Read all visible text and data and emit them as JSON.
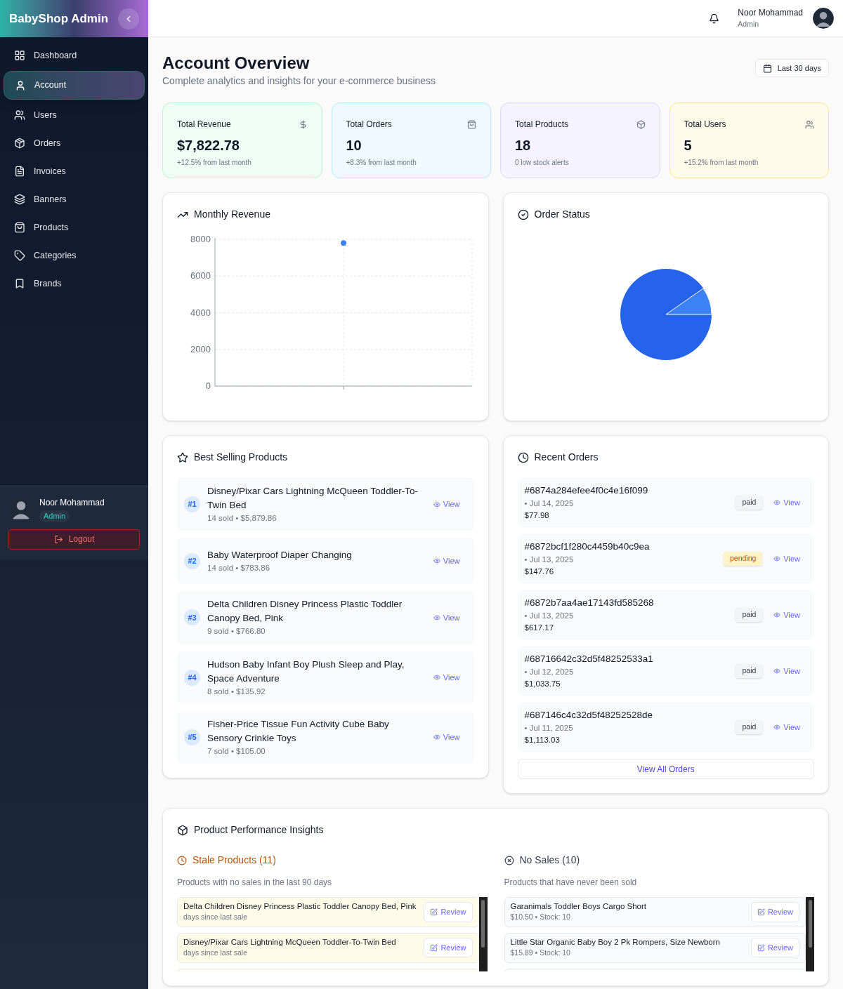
{
  "brand": "BabyShop Admin",
  "sidebar": {
    "items": [
      {
        "label": "Dashboard",
        "selected": false
      },
      {
        "label": "Account",
        "selected": true
      },
      {
        "label": "Users",
        "selected": false
      },
      {
        "label": "Orders",
        "selected": false
      },
      {
        "label": "Invoices",
        "selected": false
      },
      {
        "label": "Banners",
        "selected": false
      },
      {
        "label": "Products",
        "selected": false
      },
      {
        "label": "Categories",
        "selected": false
      },
      {
        "label": "Brands",
        "selected": false
      }
    ],
    "user": {
      "name": "Noor Mohammad",
      "role": "Admin"
    },
    "logout": "Logout"
  },
  "header": {
    "user": {
      "name": "Noor Mohammad",
      "role": "Admin"
    }
  },
  "page": {
    "title": "Account Overview",
    "subtitle": "Complete analytics and insights for your e-commerce business",
    "range": "Last 30 days"
  },
  "stats": [
    {
      "title": "Total Revenue",
      "value": "$7,822.78",
      "note": "+12.5% from last month",
      "color": "#f0fdf4"
    },
    {
      "title": "Total Orders",
      "value": "10",
      "note": "+8.3% from last month",
      "color": "#f0f9ff"
    },
    {
      "title": "Total Products",
      "value": "18",
      "note": "0 low stock alerts",
      "color": "#f5f3ff"
    },
    {
      "title": "Total Users",
      "value": "5",
      "note": "+15.2% from last month",
      "color": "#fffbeb"
    }
  ],
  "revenue": {
    "chart_data": {
      "type": "line",
      "title": "Monthly Revenue",
      "grid": true,
      "series": [
        {
          "color": "#3b82f6",
          "marker": true,
          "values": [
            7800
          ]
        }
      ],
      "ylim": [
        0,
        8000
      ],
      "yticks": [
        0,
        2000,
        4000,
        6000,
        8000
      ]
    }
  },
  "order_status": {
    "title": "Order Status"
  },
  "best_selling": {
    "title": "Best Selling Products",
    "items": [
      {
        "rank": "#1",
        "name": "Disney/Pixar Cars Lightning McQueen Toddler-To-Twin Bed",
        "sales": "14 sold • $5,879.86",
        "action": "View"
      },
      {
        "rank": "#2",
        "name": "Baby Waterproof Diaper Changing",
        "sales": "14 sold • $783.86",
        "action": "View"
      },
      {
        "rank": "#3",
        "name": "Delta Children Disney Princess Plastic Toddler Canopy Bed, Pink",
        "sales": "9 sold • $766.80",
        "action": "View"
      },
      {
        "rank": "#4",
        "name": "Hudson Baby Infant Boy Plush Sleep and Play, Space Adventure",
        "sales": "8 sold • $135.92",
        "action": "View"
      },
      {
        "rank": "#5",
        "name": "Fisher-Price Tissue Fun Activity Cube Baby Sensory Crinkle Toys",
        "sales": "7 sold • $105.00",
        "action": "View"
      }
    ]
  },
  "recent_orders": {
    "title": "Recent Orders",
    "items": [
      {
        "id": "#6874a284efee4f0c4e16f099",
        "date": "• Jul 14, 2025",
        "amount": "$77.98",
        "status": "paid",
        "color": "#f3f4f6",
        "action": "View"
      },
      {
        "id": "#6872bcf1f280c4459b40c9ea",
        "date": "• Jul 13, 2025",
        "amount": "$147.76",
        "status": "pending",
        "color": "#fef3c7",
        "action": "View"
      },
      {
        "id": "#6872b7aa4ae17143fd585268",
        "date": "• Jul 13, 2025",
        "amount": "$617.17",
        "status": "paid",
        "color": "#f3f4f6",
        "action": "View"
      },
      {
        "id": "#68716642c32d5f48252533a1",
        "date": "• Jul 12, 2025",
        "amount": "$1,033.75",
        "status": "paid",
        "color": "#f3f4f6",
        "action": "View"
      },
      {
        "id": "#687146c4c32d5f48252528de",
        "date": "• Jul 11, 2025",
        "amount": "$1,113.03",
        "status": "paid",
        "color": "#f3f4f6",
        "action": "View"
      }
    ],
    "view_all": "View All Orders"
  },
  "insights": {
    "title": "Product Performance Insights",
    "stale": {
      "title": "Stale Products (11)",
      "subtitle": "Products with no sales in the last 90 days",
      "items": [
        {
          "name": "Delta Children Disney Princess Plastic Toddler Canopy Bed, Pink",
          "detail": "days since last sale",
          "action": "Review"
        },
        {
          "name": "Disney/Pixar Cars Lightning McQueen Toddler-To-Twin Bed",
          "detail": "days since last sale",
          "action": "Review"
        }
      ]
    },
    "no_sales": {
      "title": "No Sales (10)",
      "subtitle": "Products that have never been sold",
      "items": [
        {
          "name": "Garanimals Toddler Boys Cargo Short",
          "detail": "$10.50 • Stock: 10",
          "action": "Review"
        },
        {
          "name": "Little Star Organic Baby Boy 2 Pk Rompers, Size Newborn",
          "detail": "$15.89 • Stock: 10",
          "action": "Review"
        }
      ]
    }
  }
}
